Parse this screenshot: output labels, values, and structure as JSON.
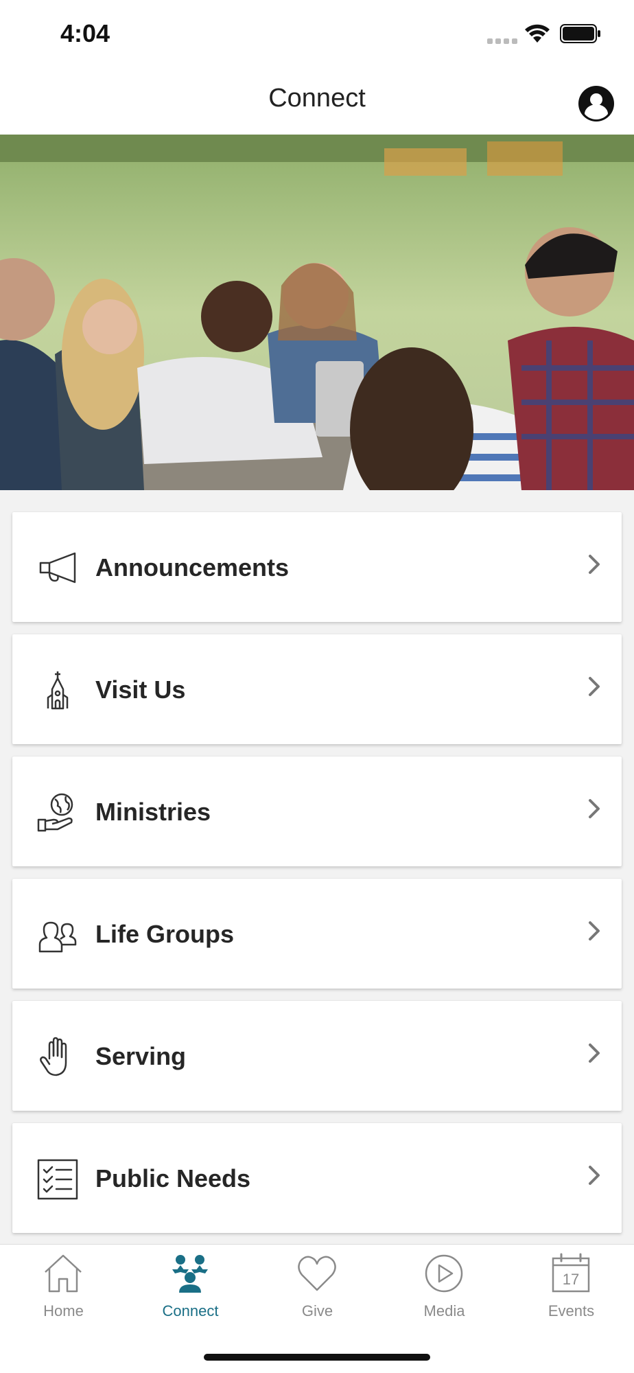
{
  "status_bar": {
    "time": "4:04"
  },
  "header": {
    "title": "Connect"
  },
  "menu": {
    "items": [
      {
        "label": "Announcements",
        "icon": "megaphone-icon"
      },
      {
        "label": "Visit Us",
        "icon": "church-icon"
      },
      {
        "label": "Ministries",
        "icon": "globe-hand-icon"
      },
      {
        "label": "Life Groups",
        "icon": "people-icon"
      },
      {
        "label": "Serving",
        "icon": "raised-hand-icon"
      },
      {
        "label": "Public Needs",
        "icon": "checklist-icon"
      }
    ]
  },
  "tab_bar": {
    "active": "Connect",
    "accent_color": "#1a6f86",
    "inactive_color": "#8a8a8a",
    "tabs": [
      {
        "label": "Home",
        "icon": "home-icon"
      },
      {
        "label": "Connect",
        "icon": "connect-group-icon"
      },
      {
        "label": "Give",
        "icon": "heart-icon"
      },
      {
        "label": "Media",
        "icon": "play-circle-icon"
      },
      {
        "label": "Events",
        "icon": "calendar-icon",
        "badge": "17"
      }
    ]
  }
}
